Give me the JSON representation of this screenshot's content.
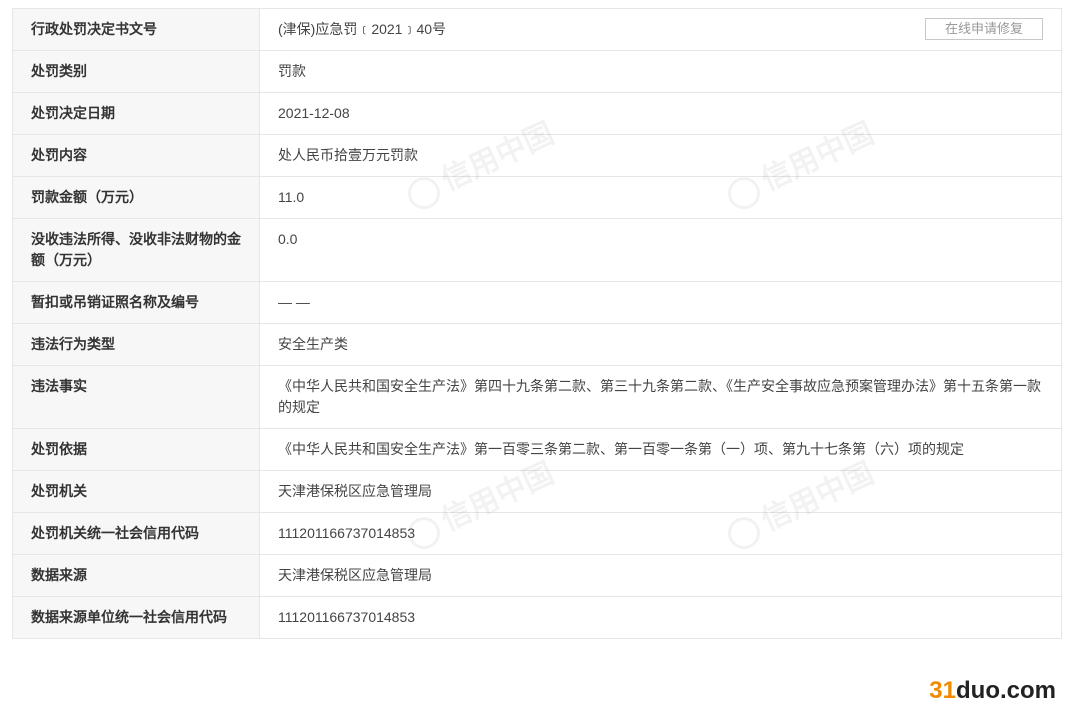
{
  "repair_button": "在线申请修复",
  "rows": [
    {
      "label": "行政处罚决定书文号",
      "value": "(津保)应急罚﹝2021﹞40号"
    },
    {
      "label": "处罚类别",
      "value": "罚款"
    },
    {
      "label": "处罚决定日期",
      "value": "2021-12-08"
    },
    {
      "label": "处罚内容",
      "value": "处人民币拾壹万元罚款"
    },
    {
      "label": "罚款金额（万元）",
      "value": "11.0"
    },
    {
      "label": "没收违法所得、没收非法财物的金额（万元）",
      "value": "0.0"
    },
    {
      "label": "暂扣或吊销证照名称及编号",
      "value": "— —"
    },
    {
      "label": "违法行为类型",
      "value": "安全生产类"
    },
    {
      "label": "违法事实",
      "value": "《中华人民共和国安全生产法》第四十九条第二款、第三十九条第二款、《生产安全事故应急预案管理办法》第十五条第一款的规定"
    },
    {
      "label": "处罚依据",
      "value": "《中华人民共和国安全生产法》第一百零三条第二款、第一百零一条第（一）项、第九十七条第（六）项的规定"
    },
    {
      "label": "处罚机关",
      "value": "天津港保税区应急管理局"
    },
    {
      "label": "处罚机关统一社会信用代码",
      "value": "111201166737014853"
    },
    {
      "label": "数据来源",
      "value": "天津港保税区应急管理局"
    },
    {
      "label": "数据来源单位统一社会信用代码",
      "value": "111201166737014853"
    }
  ],
  "watermark": "信用中国",
  "site_logo": {
    "num": "31",
    "rest": "duo.com"
  }
}
